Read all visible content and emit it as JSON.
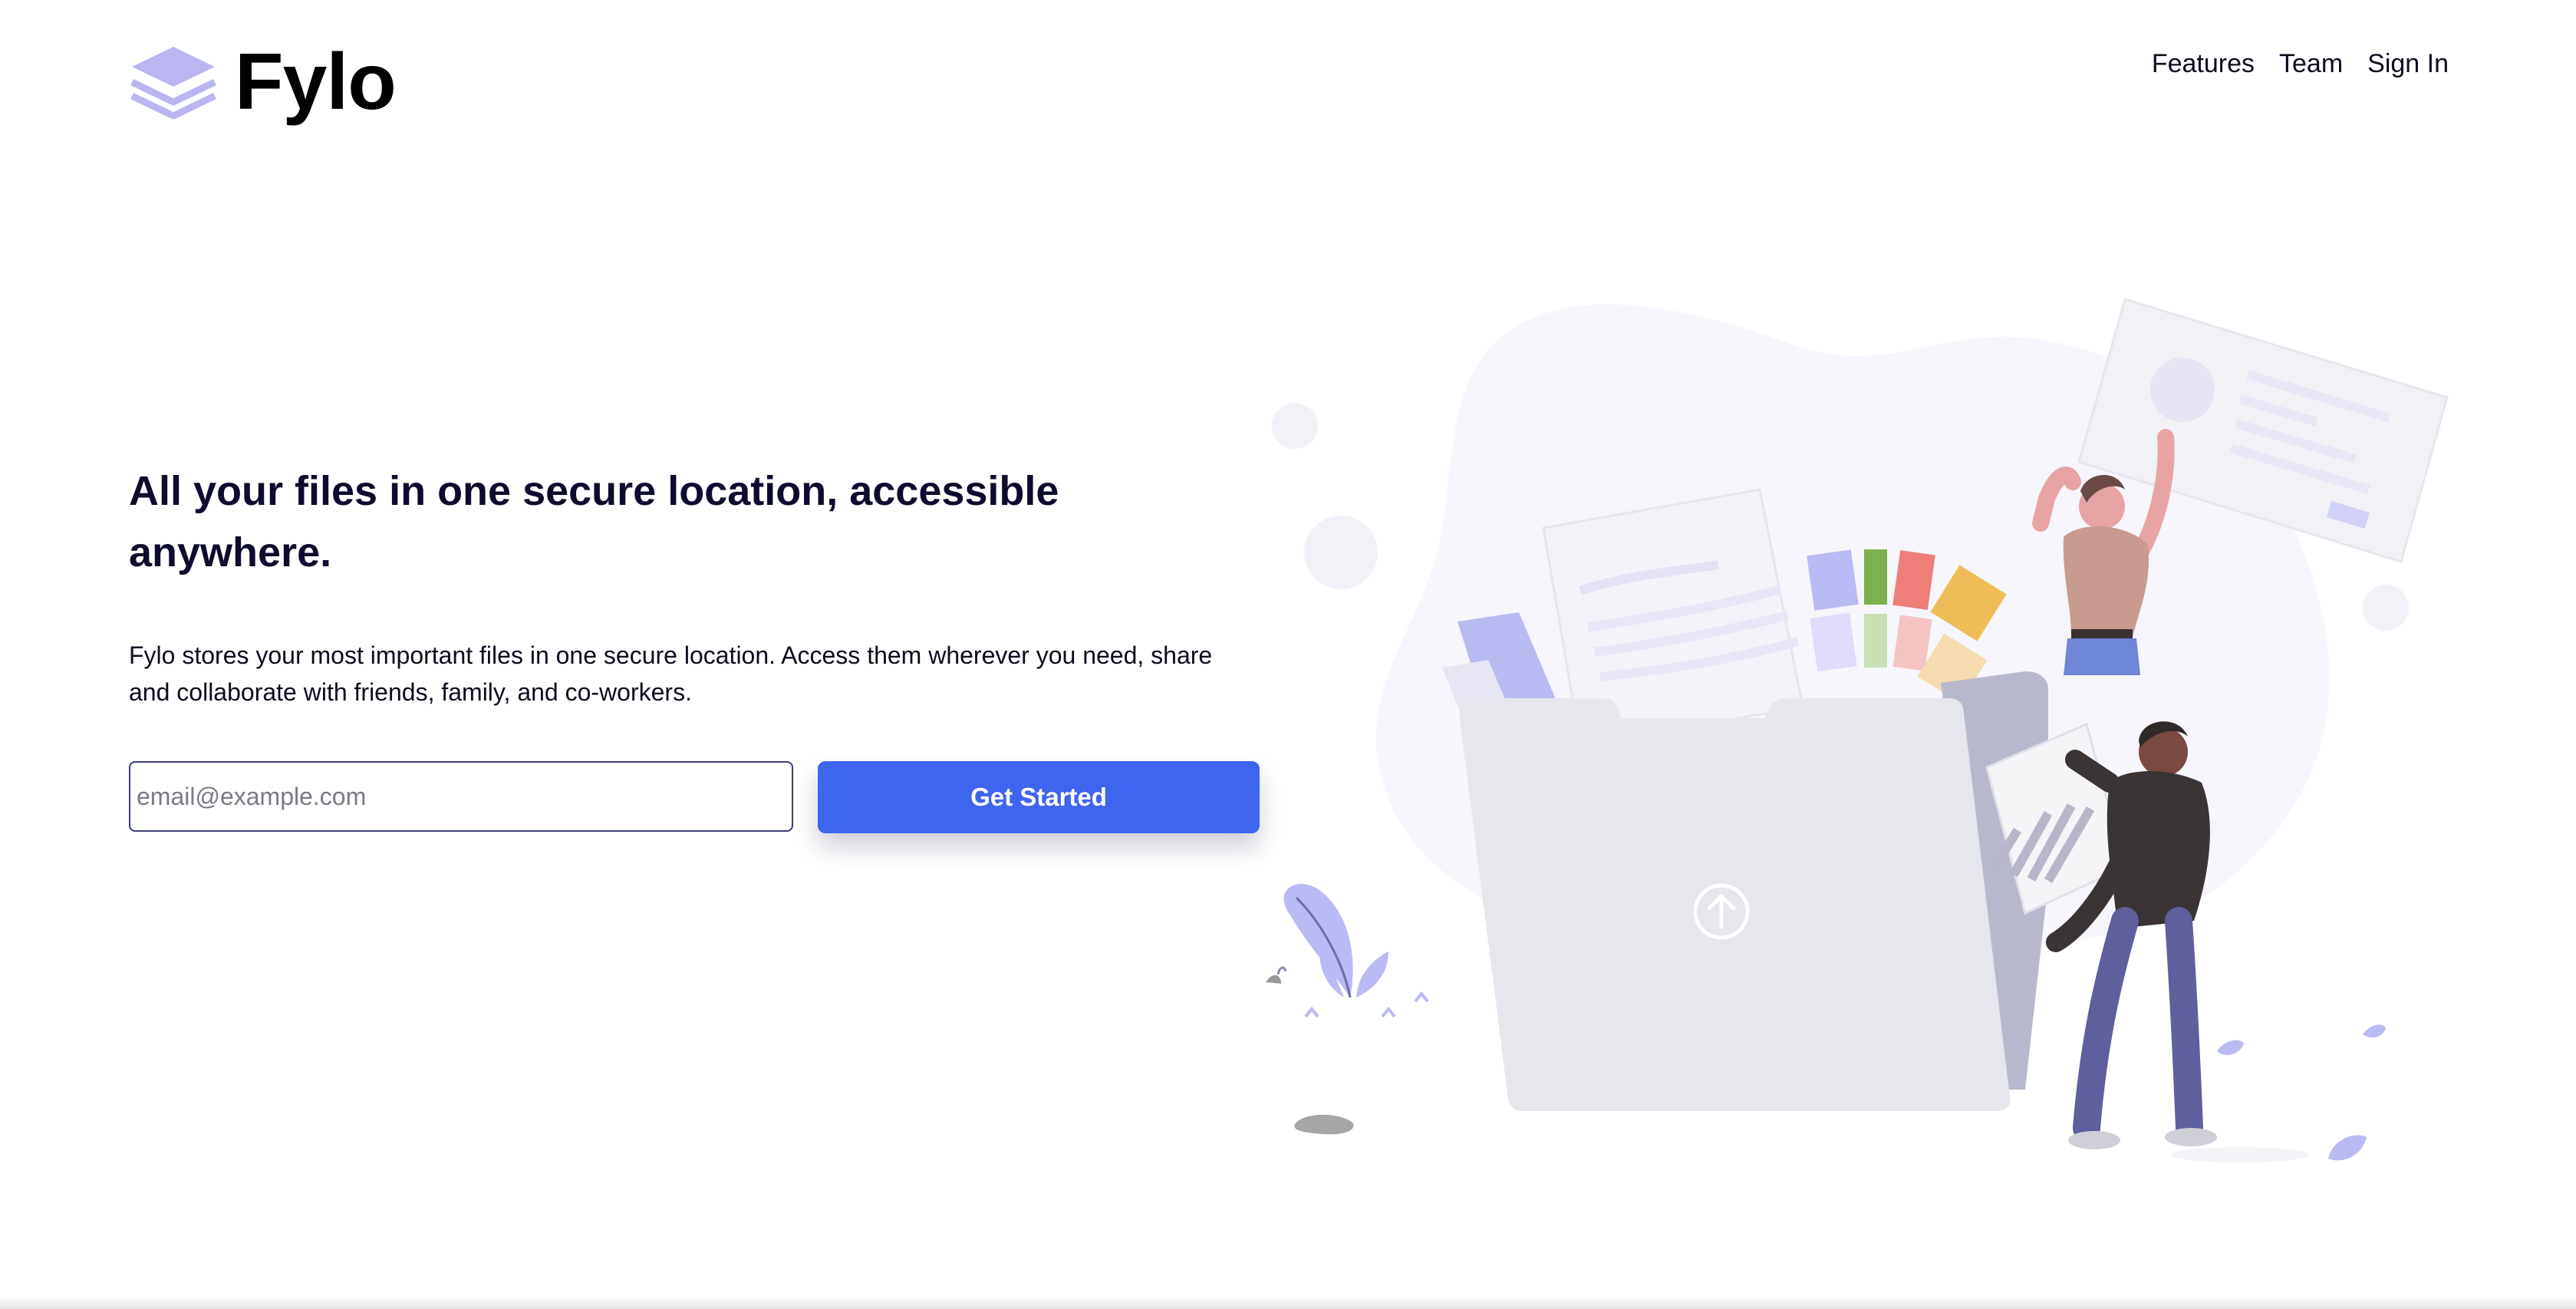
{
  "header": {
    "logo_text": "Fylo",
    "logo_icon": "stacked-layers-icon",
    "nav": [
      {
        "label": "Features"
      },
      {
        "label": "Team"
      },
      {
        "label": "Sign In"
      }
    ]
  },
  "hero": {
    "title": "All your files in one secure location, accessible anywhere.",
    "description": "Fylo stores your most important files in one secure location. Access them wherever you need, share and collaborate with friends, family, and co-workers.",
    "email_placeholder": "email@example.com",
    "cta_label": "Get Started",
    "illustration_icon": "upload-icon"
  },
  "colors": {
    "accent": "#3e65ee",
    "heading": "#0d0c2e",
    "logo_purple": "#b8b6f2",
    "folder": "#e6e7ec"
  }
}
